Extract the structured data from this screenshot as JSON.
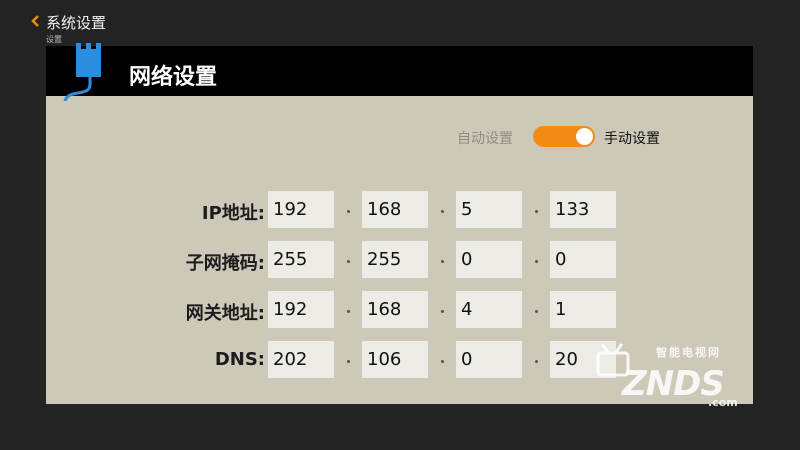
{
  "topbar": {
    "title": "系统设置",
    "subtitle": "设置",
    "back_icon": "chevron-left-icon",
    "accent": "#f08c16"
  },
  "panel": {
    "title": "网络设置",
    "icon": "network-plug-icon",
    "header_bg": "#000000",
    "bg": "#cdc9b9"
  },
  "mode": {
    "auto_label": "自动设置",
    "manual_label": "手动设置",
    "selected": "手动设置",
    "toggle_color": "#f08c16"
  },
  "rows": [
    {
      "label": "IP地址:",
      "octets": [
        "192",
        "168",
        "5",
        "133"
      ]
    },
    {
      "label": "子网掩码:",
      "octets": [
        "255",
        "255",
        "0",
        "0"
      ]
    },
    {
      "label": "网关地址:",
      "octets": [
        "192",
        "168",
        "4",
        "1"
      ]
    },
    {
      "label": "DNS:",
      "octets": [
        "202",
        "106",
        "0",
        "20"
      ]
    }
  ],
  "watermark": {
    "brand": "ZNDS",
    "tagline": "智能电视网",
    "suffix": ".com"
  }
}
